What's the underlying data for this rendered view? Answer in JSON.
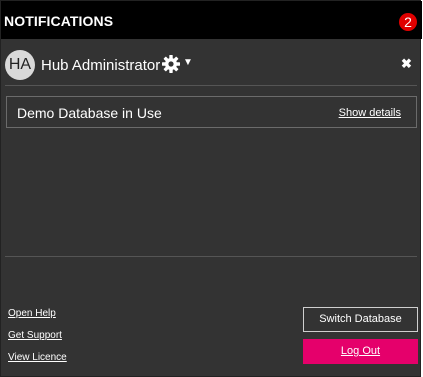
{
  "header": {
    "title": "NOTIFICATIONS",
    "badge_count": "2"
  },
  "user": {
    "initials": "HA",
    "name": "Hub Administrator"
  },
  "icons": {
    "gear": "gear-icon",
    "caret": "caret-down-icon",
    "close": "close-icon"
  },
  "notification": {
    "text": "Demo Database in Use",
    "link": "Show details"
  },
  "footer": {
    "links": [
      "Open Help",
      "Get Support",
      "View Licence"
    ],
    "switch_label": "Switch Database",
    "logout_label": "Log Out"
  },
  "colors": {
    "panel_bg": "#333333",
    "header_bg": "#000000",
    "badge": "#e00000",
    "logout": "#e5006b"
  }
}
